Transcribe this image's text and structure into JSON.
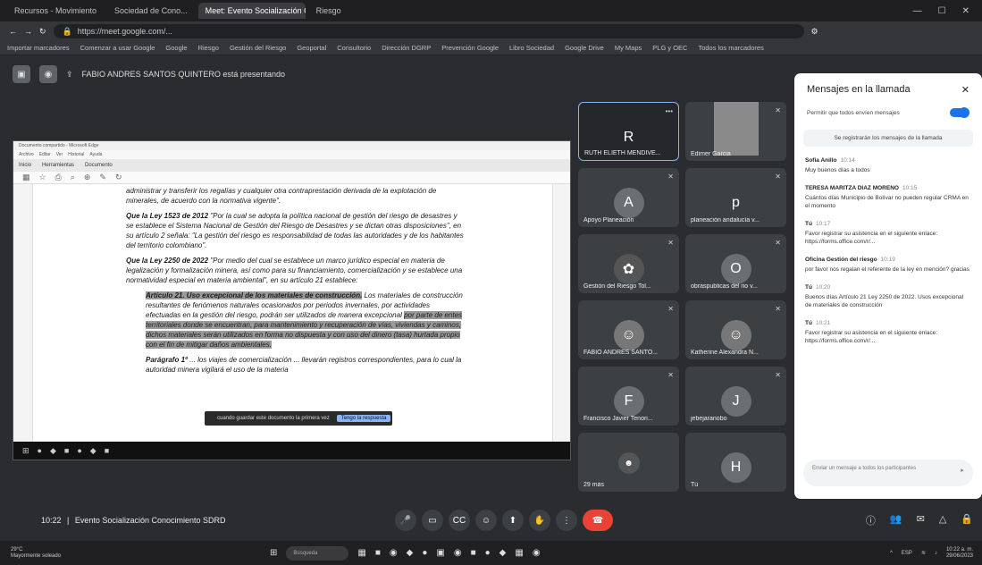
{
  "browser": {
    "tabs": [
      "Recursos - Movimiento",
      "Sociedad de Cono...",
      "Meet: Evento Socialización Co...",
      "Riesgo"
    ],
    "address": "https://meet.google.com/...",
    "bookmarks": [
      "Importar marcadores",
      "Comenzar a usar Google",
      "Google",
      "Riesgo",
      "Gestión del Riesgo",
      "Geoportal",
      "Consultorio",
      "Dirección DGRP",
      "Prevención Google",
      "Libro Sociedad",
      "Google Drive",
      "My Maps",
      "PLG y OEC",
      "Todos los marcadores"
    ]
  },
  "presenting": "FABIO ANDRES SANTOS QUINTERO está presentando",
  "shared": {
    "title": "Documento compartido - Microsoft Edge",
    "menu": [
      "Archivo",
      "Editar",
      "Ver",
      "Historial",
      "Ayuda"
    ],
    "tabs": [
      "Inicio",
      "Herramientas",
      "Documento"
    ],
    "p1": "administrar y transferir los regalías y cualquier otra contraprestación derivada de la explotación de minerales, de acuerdo con la normativa vigente\".",
    "p2a": "Que la Ley 1523 de 2012",
    "p2b": " \"Por la cual se adopta la política nacional de gestión del riesgo de desastres y se establece el Sistema Nacional de Gestión del Riesgo de Desastres y se dictan otras disposiciones\", en su artículo 2 señala: \"La gestión del riesgo es responsabilidad de todas las autoridades y de los habitantes del territorio colombiano\".",
    "p3a": "Que la Ley 2250 de 2022",
    "p3b": " \"Por medio del cual se establece un marco jurídico especial en materia de legalización y formalización minera, así como para su financiamiento, comercialización y se establece una normatividad especial en materia ambiental\", en su artículo 21 establece:",
    "p4a": "Artículo 21. Uso excepcional de los materiales de construcción.",
    "p4b": " Los materiales de construcción resultantes de fenómenos naturales ocasionados por periodos invernales, por actividades efectuadas en la gestión del riesgo, podrán ser utilizados de manera excepcional ",
    "p4c": "por parte de entes territoriales donde se encuentran, para mantenimiento y recuperación de vías, viviendas y caminos, dichos materiales serán utilizados en forma no dispuesta y con uso del dinero (tasa) hurtada propio con el fin de mitigar daños ambientales.",
    "p5a": "Parágrafo 1º",
    "p5b": " ... los viajes de comercialización ... llevarán registros correspondientes, para lo cual la autoridad minera vigilará el uso de la materia",
    "toast": "cuando guardar este documento la primera vez",
    "toast_btn": "Tengo la respuesta"
  },
  "participants": [
    {
      "initial": "R",
      "name": "RUTH ELIETH MENDIVE...",
      "color": "#3c4043"
    },
    {
      "initial": "",
      "name": "Edimer Garcia",
      "color": "#7a7a7a"
    },
    {
      "initial": "A",
      "name": "Apoyo Planeación",
      "color": "#6b6f74"
    },
    {
      "initial": "p",
      "name": "planeación andalucía v...",
      "color": "#3c4043"
    },
    {
      "initial": "",
      "name": "Gestión del Riesgo Tol...",
      "color": "#555"
    },
    {
      "initial": "O",
      "name": "obraspublicas del rio v...",
      "color": "#6b6f74"
    },
    {
      "initial": "",
      "name": "FABIO ANDRES SANTO...",
      "color": "#555"
    },
    {
      "initial": "",
      "name": "Katherine Alexandra N...",
      "color": "#555"
    },
    {
      "initial": "F",
      "name": "Francisco Javier Tenori...",
      "color": "#6b6f74"
    },
    {
      "initial": "J",
      "name": "jebejaranobo",
      "color": "#6b6f74"
    },
    {
      "initial": "",
      "name": "29 más",
      "color": "#3c4043"
    },
    {
      "initial": "H",
      "name": "Tú",
      "color": "#6b6f74"
    }
  ],
  "chat": {
    "title": "Mensajes en la llamada",
    "toggle": "Permitir que todos envíen mensajes",
    "note": "Se registrarán los mensajes de la llamada",
    "messages": [
      {
        "who": "Sofia Anillo",
        "time": "10:14",
        "text": "Muy buenos días a todos"
      },
      {
        "who": "TERESA MARITZA DIAZ MORENO",
        "time": "10:15",
        "text": "Cuántos días Municipio de Bolívar no pueden regular CRMA en el momento"
      },
      {
        "who": "Tú",
        "time": "10:17",
        "text": "Favor registrar su asistencia en el siguiente enlace: https://forms.office.com/r/..."
      },
      {
        "who": "Oficina Gestión del riesgo",
        "time": "10:19",
        "text": "por favor nos regalan el referente de la ley en mención? gracias"
      },
      {
        "who": "Tú",
        "time": "10:20",
        "text": "Buenos días Artículo 21 Ley 2250 de 2022. Usos excepcional de materiales de construcción"
      },
      {
        "who": "Tú",
        "time": "10:21",
        "text": "Favor registrar su asistencia en el siguiente enlace: https://forms.office.com/r/..."
      }
    ],
    "input": "Enviar un mensaje a todos los participantes"
  },
  "meeting": {
    "time": "10:22",
    "sep": "|",
    "name": "Evento Socialización Conocimiento SDRD"
  },
  "taskbar": {
    "weather": "29°C",
    "weather2": "Mayormente soleado",
    "search": "Búsqueda",
    "lang": "ESP",
    "date": "10:22 a. m.",
    "date2": "29/06/2023"
  }
}
